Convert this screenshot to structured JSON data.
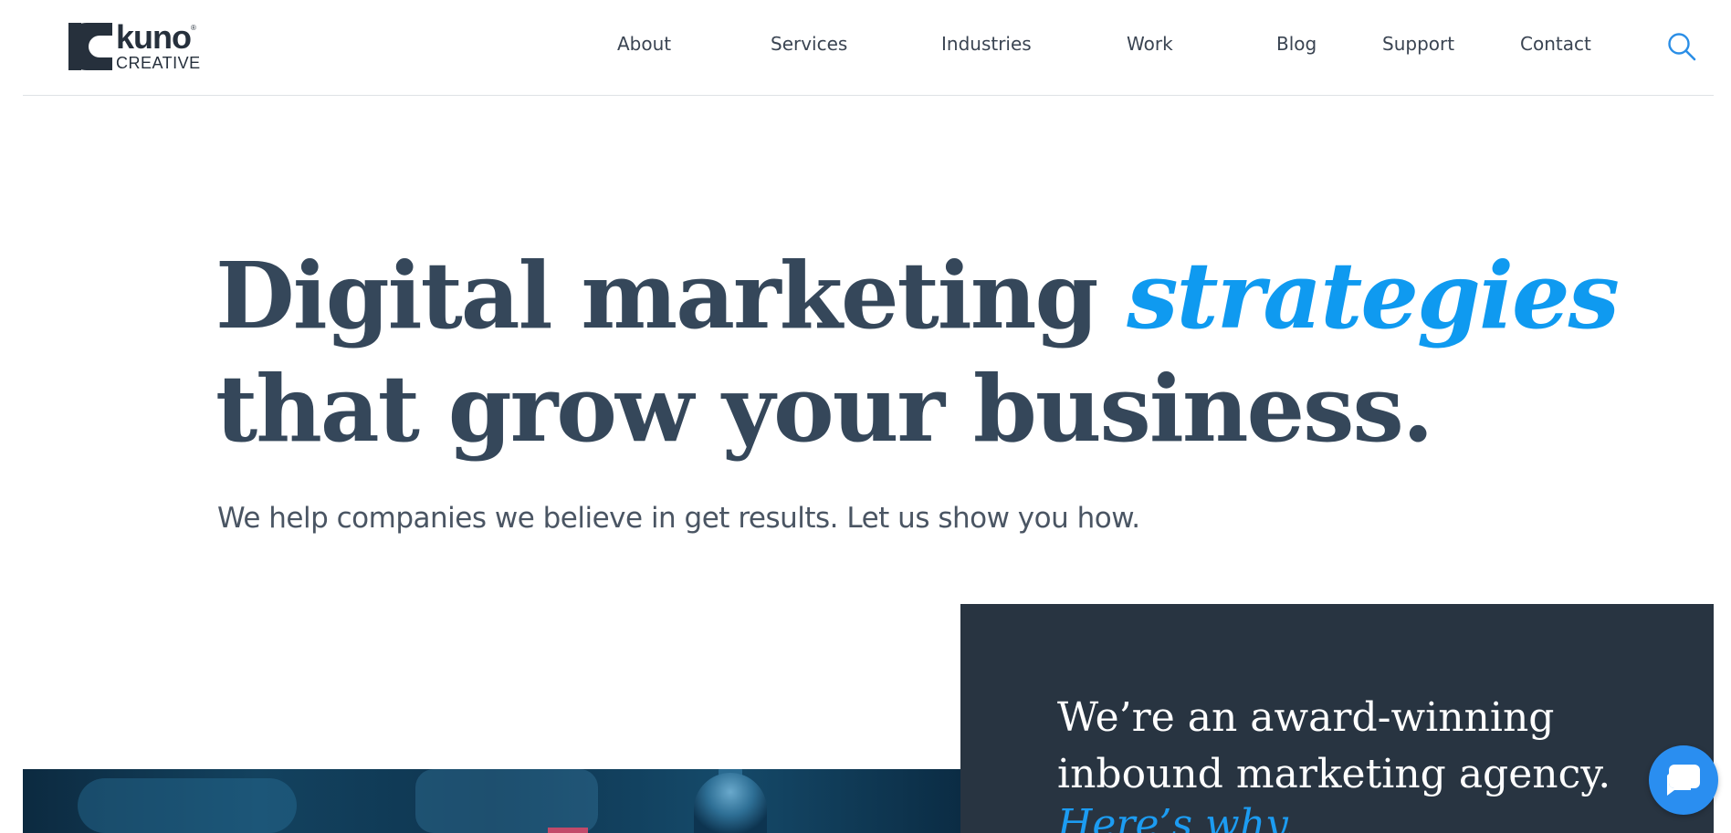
{
  "brand": {
    "logo_word": "kuno",
    "logo_sub": "CREATIVE",
    "logo_mark": "®"
  },
  "nav": {
    "items": [
      {
        "label": "About"
      },
      {
        "label": "Services"
      },
      {
        "label": "Industries"
      },
      {
        "label": "Work"
      },
      {
        "label": "Blog"
      },
      {
        "label": "Support"
      },
      {
        "label": "Contact"
      }
    ],
    "search_icon": "search-icon"
  },
  "hero": {
    "title_part1": "Digital marketing",
    "title_accent": "strategies",
    "title_line2": "that grow your business.",
    "subtitle": "We help companies we believe in get results. Let us show you how."
  },
  "award": {
    "text": "We’re an award-winning inbound marketing agency.",
    "link": "Here’s why."
  },
  "chat": {
    "icon": "chat-icon"
  },
  "colors": {
    "heading": "#35475a",
    "accent": "#0f9af0",
    "panel": "#283441",
    "chat": "#2a8ef0"
  }
}
